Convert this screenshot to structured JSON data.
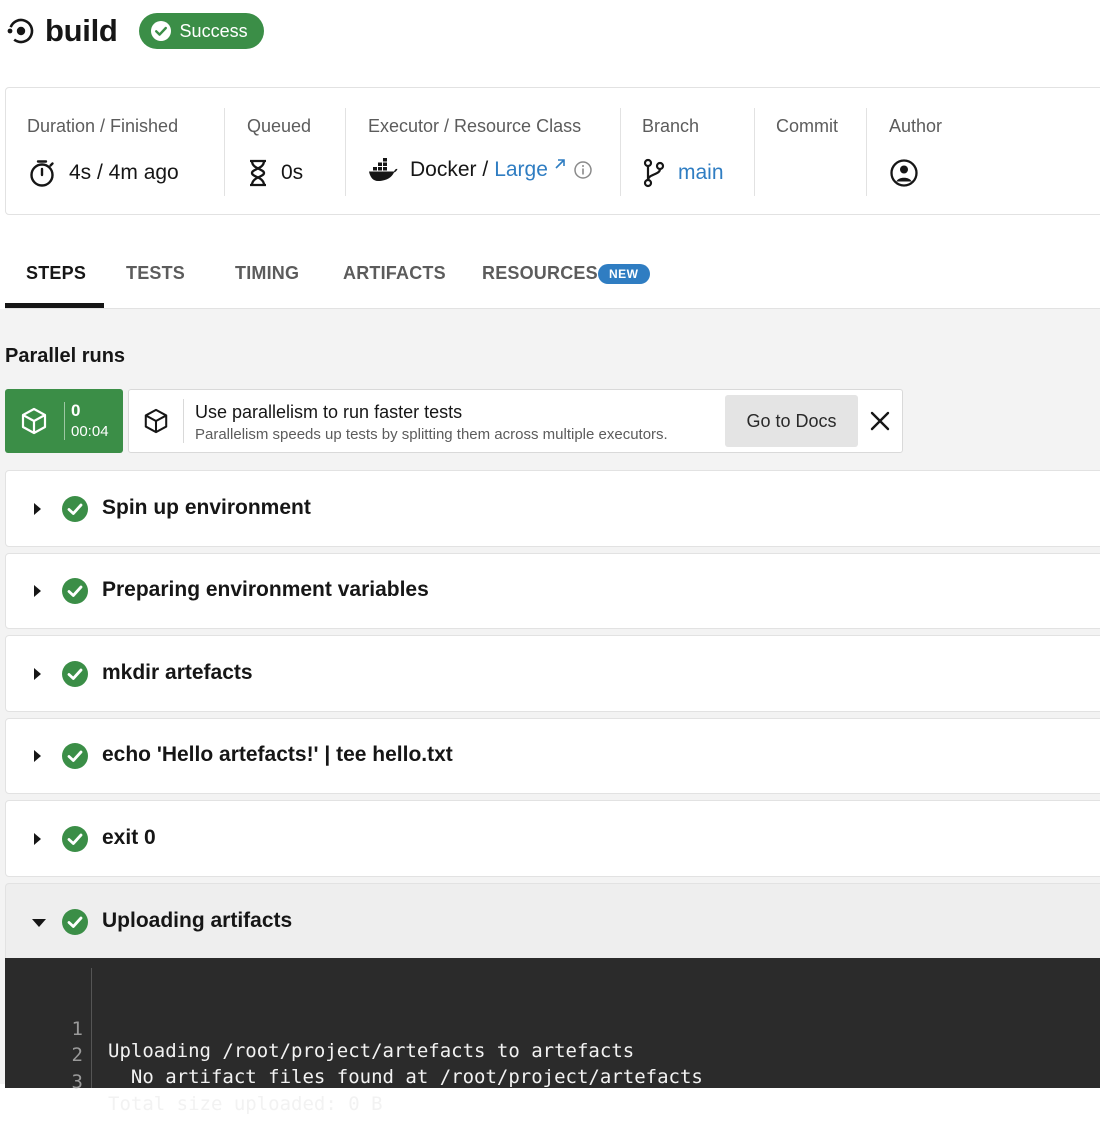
{
  "header": {
    "title": "build",
    "status": "Success",
    "status_color": "#3b8e47"
  },
  "info": {
    "duration_label": "Duration / Finished",
    "duration_value": "4s / 4m ago",
    "queued_label": "Queued",
    "queued_value": "0s",
    "executor_label": "Executor / Resource Class",
    "executor_value": "Docker / ",
    "resource_class": "Large",
    "branch_label": "Branch",
    "branch_value": "main",
    "commit_label": "Commit",
    "author_label": "Author"
  },
  "tabs": [
    {
      "label": "STEPS",
      "active": true
    },
    {
      "label": "TESTS"
    },
    {
      "label": "TIMING"
    },
    {
      "label": "ARTIFACTS"
    },
    {
      "label": "RESOURCES",
      "badge": "NEW"
    }
  ],
  "parallel": {
    "title": "Parallel runs",
    "run_index": "0",
    "run_time": "00:04",
    "promo_title": "Use parallelism to run faster tests",
    "promo_subtitle": "Parallelism speeds up tests by splitting them across multiple executors.",
    "docs_button": "Go to Docs"
  },
  "steps": [
    {
      "label": "Spin up environment",
      "status": "success"
    },
    {
      "label": "Preparing environment variables",
      "status": "success"
    },
    {
      "label": "mkdir artefacts",
      "status": "success"
    },
    {
      "label": "echo 'Hello artefacts!' | tee hello.txt",
      "status": "success"
    },
    {
      "label": "exit 0",
      "status": "success"
    },
    {
      "label": "Uploading artifacts",
      "status": "success",
      "expanded": true
    }
  ],
  "console": [
    {
      "n": "1",
      "text": "Uploading /root/project/artefacts to artefacts"
    },
    {
      "n": "2",
      "text": "  No artifact files found at /root/project/artefacts"
    },
    {
      "n": "3",
      "text": "Total size uploaded: 0 B"
    }
  ],
  "colors": {
    "success": "#3b8e47",
    "link": "#2f7dc2",
    "console_bg": "#2b2b2b"
  }
}
